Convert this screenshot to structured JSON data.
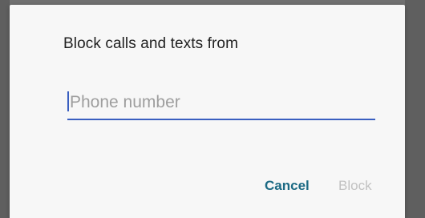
{
  "dialog": {
    "title": "Block calls and texts from",
    "input": {
      "value": "",
      "placeholder": "Phone number"
    },
    "buttons": {
      "cancel_label": "Cancel",
      "block_label": "Block"
    }
  },
  "colors": {
    "accent": "#3a5fc0",
    "cancel_text": "#1c6a84",
    "disabled_text": "#c2c2c2",
    "dialog_bg": "#f7f7f7",
    "scrim": "#707070"
  }
}
